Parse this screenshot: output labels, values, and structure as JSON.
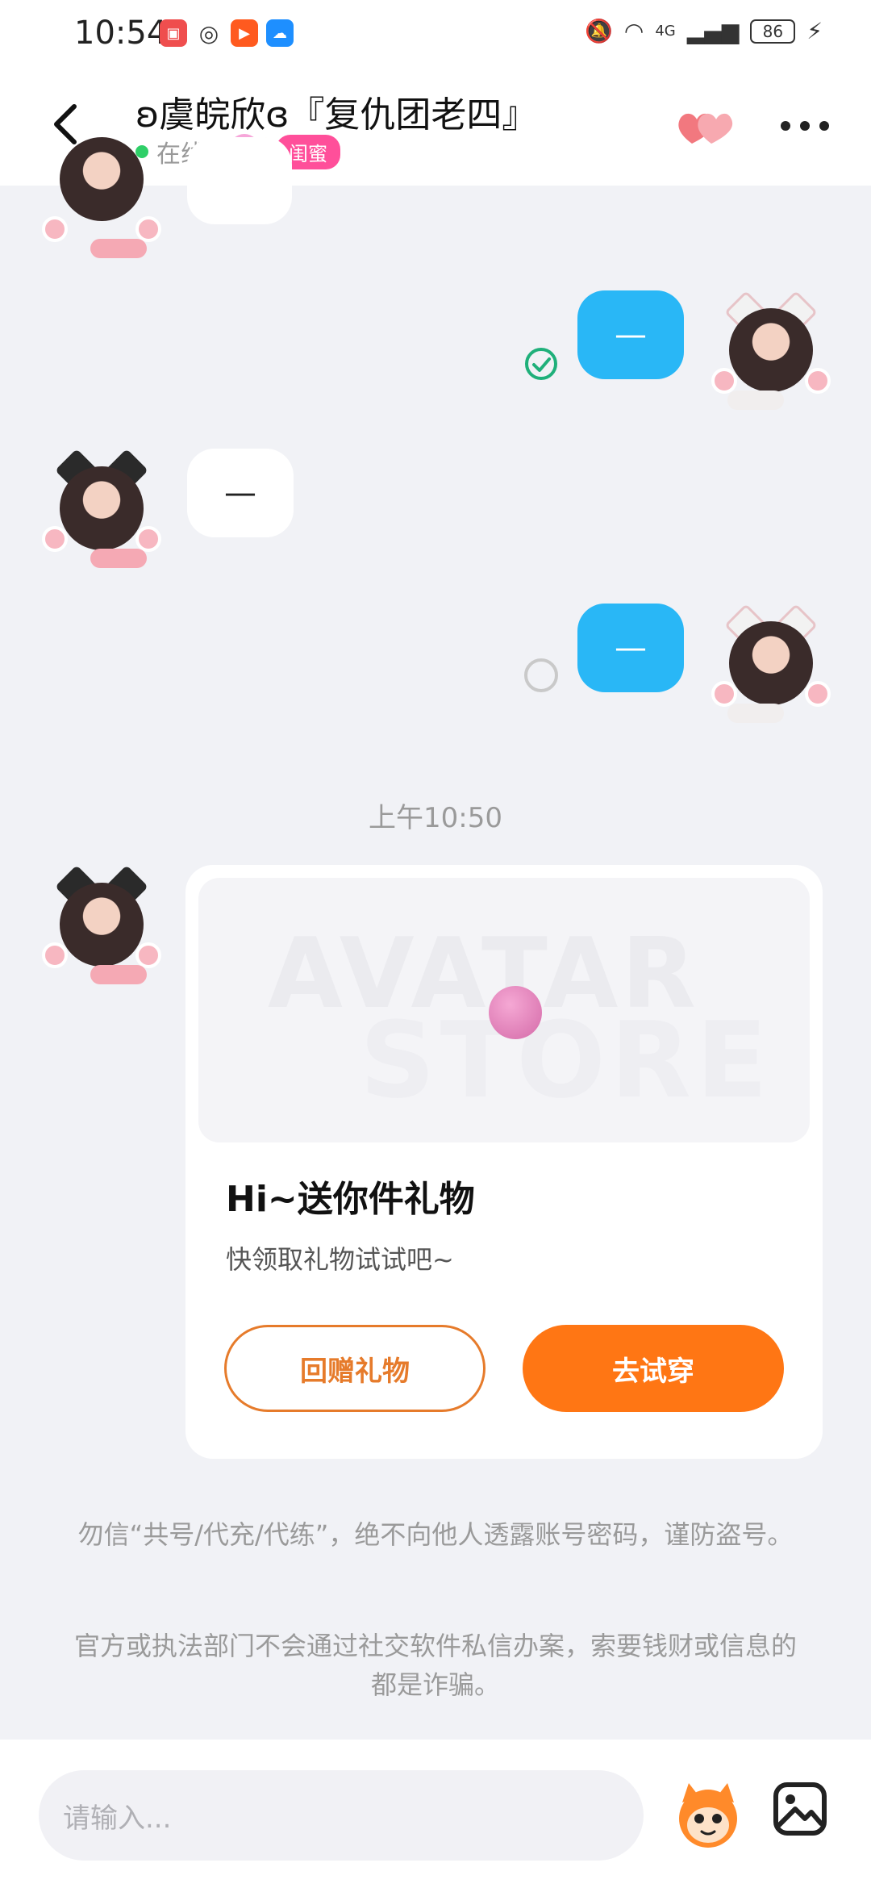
{
  "status_bar": {
    "time": "10:54",
    "battery": "86",
    "network": "4G"
  },
  "header": {
    "title": "ʚ虞皖欣ɞ『复仇团老四』",
    "presence": "在线",
    "relation_badge": "闺蜜"
  },
  "messages": [
    {
      "side": "in",
      "text": ""
    },
    {
      "side": "out",
      "text": "—",
      "status": "read"
    },
    {
      "side": "in",
      "text": "—"
    },
    {
      "side": "out",
      "text": "—",
      "status": "unread"
    }
  ],
  "timestamp": "上午10:50",
  "gift_card": {
    "watermark_line1": "AVATAR",
    "watermark_line2": "STORE",
    "title": "Hi~送你件礼物",
    "subtitle": "快领取礼物试试吧~",
    "return_gift_button": "回赠礼物",
    "try_on_button": "去试穿"
  },
  "notices": [
    "勿信“共号/代充/代练”，绝不向他人透露账号密码，谨防盗号。",
    "官方或执法部门不会通过社交软件私信办案，索要钱财或信息的都是诈骗。"
  ],
  "input": {
    "placeholder": "请输入..."
  },
  "colors": {
    "accent_orange": "#ff7614",
    "outgoing_bubble": "#29b7f6",
    "online_dot": "#2fcf68",
    "badge_pink": "#ff4f9a"
  },
  "icons": [
    "back-arrow-icon",
    "hearts-icon",
    "more-icon",
    "read-check-icon",
    "unread-circle-icon",
    "mascot-icon",
    "image-icon"
  ]
}
